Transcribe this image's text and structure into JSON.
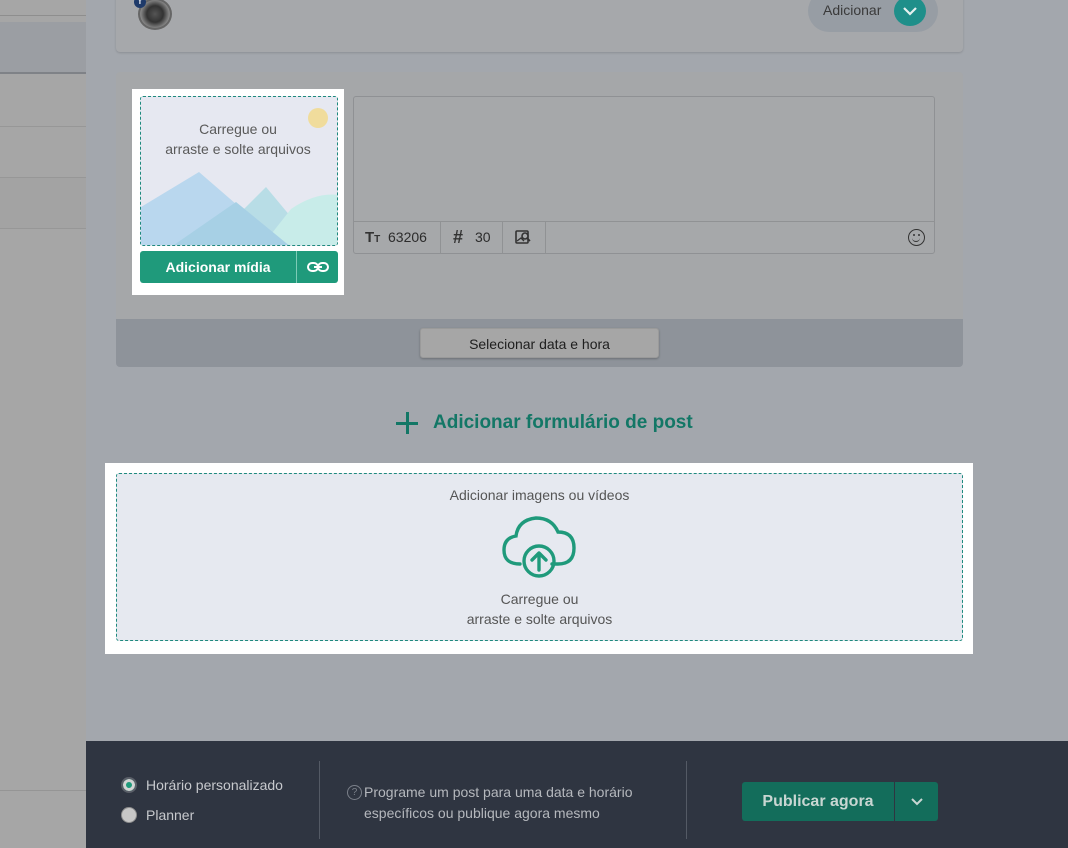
{
  "header": {
    "add_button_label": "Adicionar"
  },
  "post": {
    "media": {
      "drop_text_line1": "Carregue ou",
      "drop_text_line2": "arraste e solte arquivos",
      "add_media_label": "Adicionar mídia"
    },
    "editor": {
      "char_count": "63206",
      "hashtag_count": "30"
    },
    "schedule_button_label": "Selecionar data e hora"
  },
  "add_post_form_label": "Adicionar formulário de post",
  "bulk_upload": {
    "title": "Adicionar imagens ou vídeos",
    "text_line1": "Carregue ou",
    "text_line2": "arraste e solte arquivos"
  },
  "footer": {
    "options": [
      {
        "label": "Horário personalizado",
        "selected": true
      },
      {
        "label": "Planner",
        "selected": false
      }
    ],
    "help_text": "Programe um post para uma data e horário específicos ou publique agora mesmo",
    "publish_label": "Publicar agora"
  },
  "icons": {
    "text_size": "text-size-icon",
    "hashtag": "hashtag-icon",
    "image_search": "image-search-icon",
    "emoji": "emoji-icon",
    "link": "link-icon",
    "cloud_upload": "cloud-upload-icon",
    "chevron": "chevron-down-icon",
    "help": "help-icon",
    "plus": "plus-icon"
  },
  "colors": {
    "accent": "#1f9a7b",
    "accent_dark": "#137766",
    "footer_bg": "#2f3541",
    "overlay": "#a3a7ad"
  }
}
